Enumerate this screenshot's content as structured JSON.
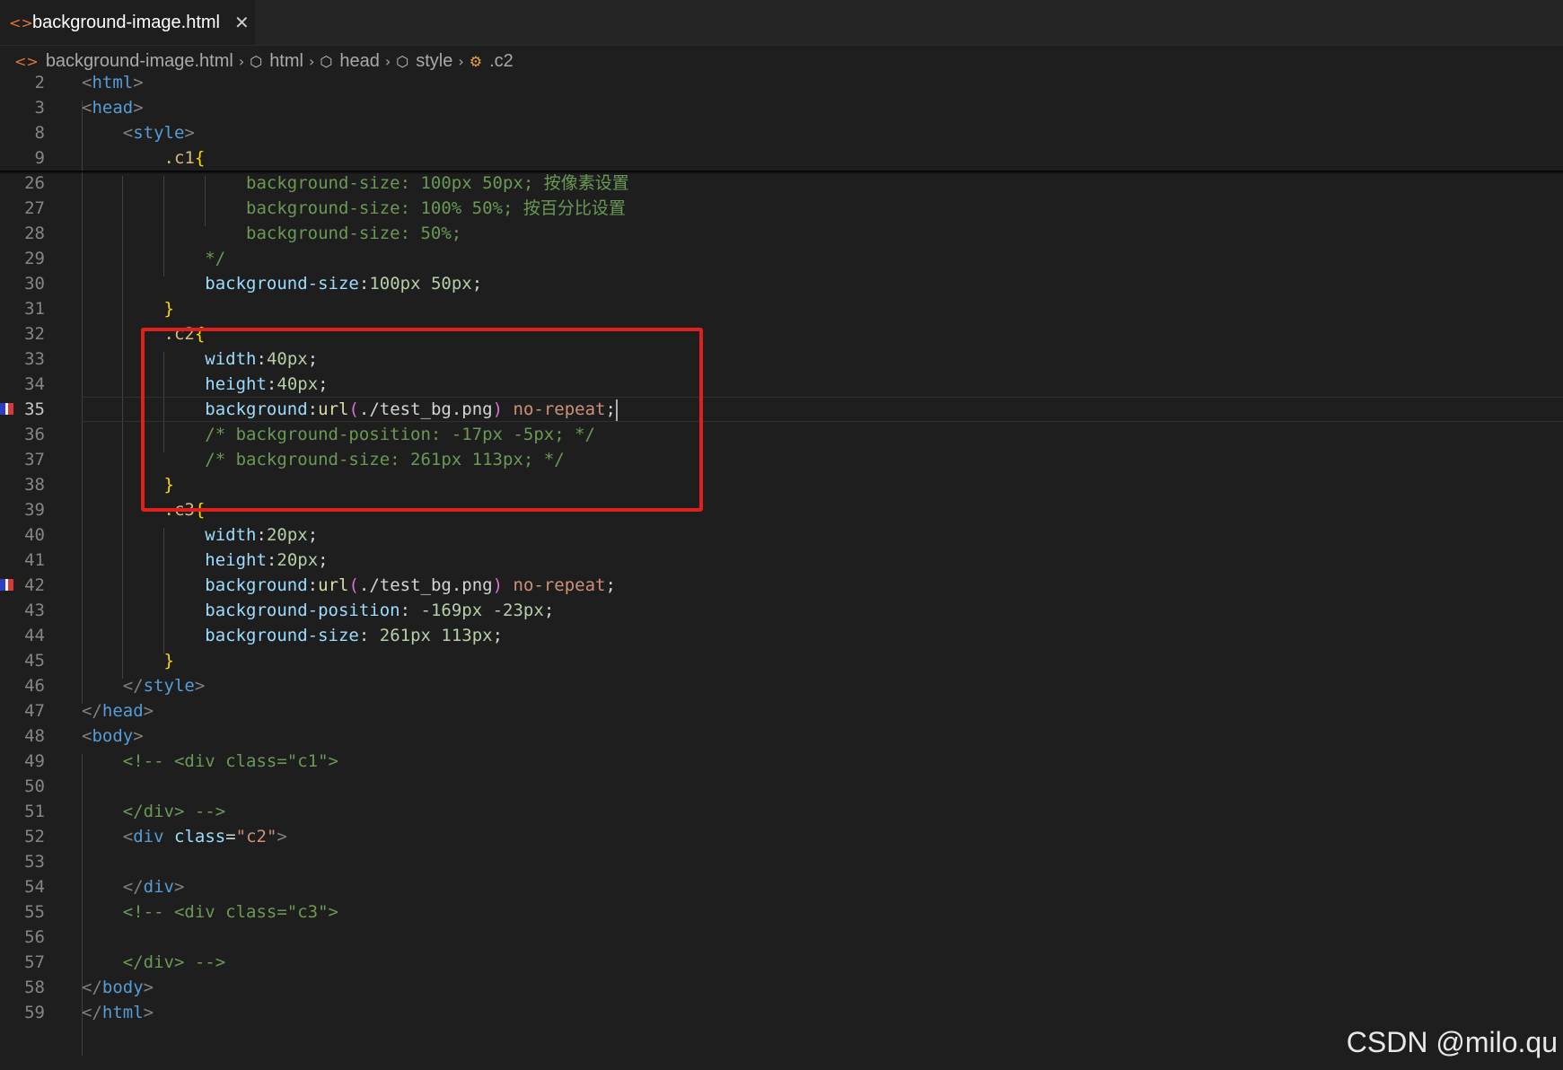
{
  "tab": {
    "title": "background-image.html",
    "icon": "html-file-icon",
    "close": "✕"
  },
  "breadcrumb": {
    "file": "background-image.html",
    "html": "html",
    "head": "head",
    "style": "style",
    "selector": ".c2"
  },
  "colors": {
    "highlight_box": "#e0201c",
    "tag": "#569cd6",
    "selector": "#d7ba7d",
    "property": "#9cdcfe",
    "comment": "#6a9955",
    "string": "#ce9178"
  },
  "current_line": "35",
  "watermark": "CSDN @milo.qu",
  "lines": [
    {
      "n": "2",
      "p": [
        "",
        "<",
        "html",
        ">"
      ]
    },
    {
      "n": "3",
      "p": [
        "",
        "<",
        "head",
        ">"
      ]
    },
    {
      "n": "8",
      "p": [
        "    ",
        "<",
        "style",
        ">"
      ]
    },
    {
      "n": "9",
      "p": [
        "        ",
        ".c1",
        "{"
      ]
    },
    {
      "n": "26",
      "p": [
        "                background-size: 100px 50px; 按像素设置"
      ]
    },
    {
      "n": "27",
      "p": [
        "                background-size: 100% 50%; 按百分比设置"
      ]
    },
    {
      "n": "28",
      "p": [
        "                background-size: 50%;"
      ]
    },
    {
      "n": "29",
      "p": [
        "            */"
      ]
    },
    {
      "n": "30",
      "p": [
        "            ",
        "background-size",
        ":",
        "100px",
        " ",
        "50px",
        ";"
      ]
    },
    {
      "n": "31",
      "p": [
        "        ",
        "}"
      ]
    },
    {
      "n": "32",
      "p": [
        "        ",
        ".c2",
        "{"
      ]
    },
    {
      "n": "33",
      "p": [
        "            ",
        "width",
        ":",
        "40px",
        ";"
      ]
    },
    {
      "n": "34",
      "p": [
        "            ",
        "height",
        ":",
        "40px",
        ";"
      ]
    },
    {
      "n": "35",
      "p": [
        "            ",
        "background",
        ":",
        "url",
        "(",
        "./test_bg.png",
        ")",
        " ",
        "no-repeat",
        ";"
      ]
    },
    {
      "n": "36",
      "p": [
        "            /* background-position: -17px -5px; */"
      ]
    },
    {
      "n": "37",
      "p": [
        "            /* background-size: 261px 113px; */"
      ]
    },
    {
      "n": "38",
      "p": [
        "        ",
        "}"
      ]
    },
    {
      "n": "39",
      "p": [
        "        ",
        ".c3",
        "{"
      ]
    },
    {
      "n": "40",
      "p": [
        "            ",
        "width",
        ":",
        "20px",
        ";"
      ]
    },
    {
      "n": "41",
      "p": [
        "            ",
        "height",
        ":",
        "20px",
        ";"
      ]
    },
    {
      "n": "42",
      "p": [
        "            ",
        "background",
        ":",
        "url",
        "(",
        "./test_bg.png",
        ")",
        " ",
        "no-repeat",
        ";"
      ]
    },
    {
      "n": "43",
      "p": [
        "            ",
        "background-position",
        ": ",
        "-169px",
        " ",
        "-23px",
        ";"
      ]
    },
    {
      "n": "44",
      "p": [
        "            ",
        "background-size",
        ": ",
        "261px",
        " ",
        "113px",
        ";"
      ]
    },
    {
      "n": "45",
      "p": [
        "        ",
        "}"
      ]
    },
    {
      "n": "46",
      "p": [
        "    ",
        "</",
        "style",
        ">"
      ]
    },
    {
      "n": "47",
      "p": [
        "",
        "</",
        "head",
        ">"
      ]
    },
    {
      "n": "48",
      "p": [
        "",
        "<",
        "body",
        ">"
      ]
    },
    {
      "n": "49",
      "p": [
        "    <!-- <div class=\"c1\">"
      ]
    },
    {
      "n": "50",
      "p": [
        ""
      ]
    },
    {
      "n": "51",
      "p": [
        "    </div> -->"
      ]
    },
    {
      "n": "52",
      "p": [
        "    ",
        "<",
        "div",
        " ",
        "class",
        "=",
        "\"c2\"",
        ">"
      ]
    },
    {
      "n": "53",
      "p": [
        ""
      ]
    },
    {
      "n": "54",
      "p": [
        "    ",
        "</",
        "div",
        ">"
      ]
    },
    {
      "n": "55",
      "p": [
        "    <!-- <div class=\"c3\">"
      ]
    },
    {
      "n": "56",
      "p": [
        ""
      ]
    },
    {
      "n": "57",
      "p": [
        "    </div> -->"
      ]
    },
    {
      "n": "58",
      "p": [
        "",
        "</",
        "body",
        ">"
      ]
    },
    {
      "n": "59",
      "p": [
        "",
        "</",
        "html",
        ">"
      ]
    }
  ]
}
